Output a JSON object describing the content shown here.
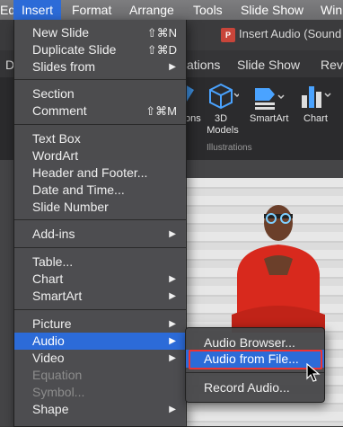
{
  "menubar": {
    "items": [
      "Edit",
      "Insert",
      "Format",
      "Arrange",
      "Tools",
      "Slide Show",
      "Win"
    ]
  },
  "window": {
    "doc_icon": "P",
    "title": "Insert Audio (Sound"
  },
  "ribbon_tabs": [
    "D",
    "ations",
    "Slide Show",
    "Revi"
  ],
  "ribbon": {
    "buttons": [
      {
        "label": "ons",
        "icon": "shapes-icon"
      },
      {
        "label": "3D\nModels",
        "icon": "3d-cube-icon"
      },
      {
        "label": "SmartArt",
        "icon": "smartart-icon"
      },
      {
        "label": "Chart",
        "icon": "chart-icon"
      }
    ],
    "group_label": "Illustrations"
  },
  "insert_menu": {
    "items": [
      {
        "label": "New Slide",
        "shortcut": "⇧⌘N"
      },
      {
        "label": "Duplicate Slide",
        "shortcut": "⇧⌘D"
      },
      {
        "label": "Slides from",
        "submenu": true
      },
      {
        "label": "Section"
      },
      {
        "label": "Comment",
        "shortcut": "⇧⌘M"
      },
      {
        "label": "Text Box"
      },
      {
        "label": "WordArt"
      },
      {
        "label": "Header and Footer..."
      },
      {
        "label": "Date and Time..."
      },
      {
        "label": "Slide Number"
      },
      {
        "label": "Add-ins",
        "submenu": true
      },
      {
        "label": "Table..."
      },
      {
        "label": "Chart",
        "submenu": true
      },
      {
        "label": "SmartArt",
        "submenu": true
      },
      {
        "label": "Picture",
        "submenu": true
      },
      {
        "label": "Audio",
        "submenu": true,
        "highlighted": true
      },
      {
        "label": "Video",
        "submenu": true
      },
      {
        "label": "Equation",
        "disabled": true
      },
      {
        "label": "Symbol...",
        "disabled": true
      },
      {
        "label": "Shape",
        "submenu": true
      }
    ]
  },
  "audio_submenu": {
    "items": [
      {
        "label": "Audio Browser..."
      },
      {
        "label": "Audio from File...",
        "highlighted": true
      },
      {
        "label": "Record Audio..."
      }
    ]
  },
  "colors": {
    "accent": "#2c6bd8",
    "highlight_outline": "#e33333"
  }
}
